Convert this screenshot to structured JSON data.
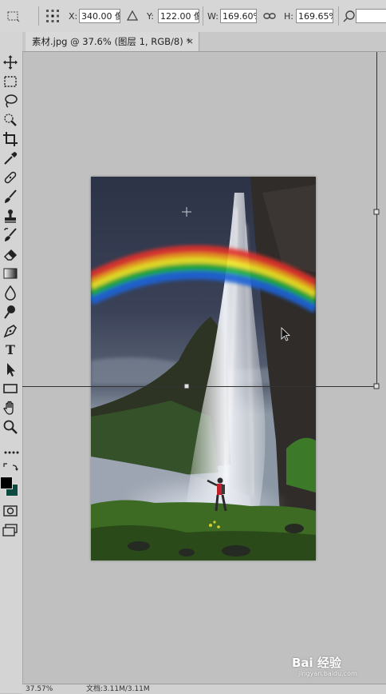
{
  "options": {
    "x_label": "X:",
    "x_value": "340.00 像",
    "y_label": "Y:",
    "y_value": "122.00 像",
    "w_label": "W:",
    "w_value": "169.60%",
    "h_label": "H:",
    "h_value": "169.65%"
  },
  "document_tab": {
    "title": "素材.jpg @ 37.6% (图层 1, RGB/8) *",
    "close": "×"
  },
  "toolbar": {
    "type_tool_label": "T",
    "tools": [
      "move-tool",
      "marquee-tool",
      "lasso-tool",
      "quick-selection-tool",
      "crop-tool",
      "eyedropper-tool",
      "healing-brush-tool",
      "brush-tool",
      "clone-stamp-tool",
      "history-brush-tool",
      "eraser-tool",
      "gradient-tool",
      "blur-tool",
      "dodge-tool",
      "pen-tool",
      "type-tool",
      "path-selection-tool",
      "rectangle-tool",
      "hand-tool",
      "zoom-tool"
    ]
  },
  "colors": {
    "foreground": "#000000",
    "background": "#0c4a3e"
  },
  "status": {
    "zoom": "37.57%",
    "doc": "文档:3.11M/3.11M"
  },
  "watermark": {
    "brand": "Bai 经验",
    "url": "jingyan.baidu.com"
  }
}
